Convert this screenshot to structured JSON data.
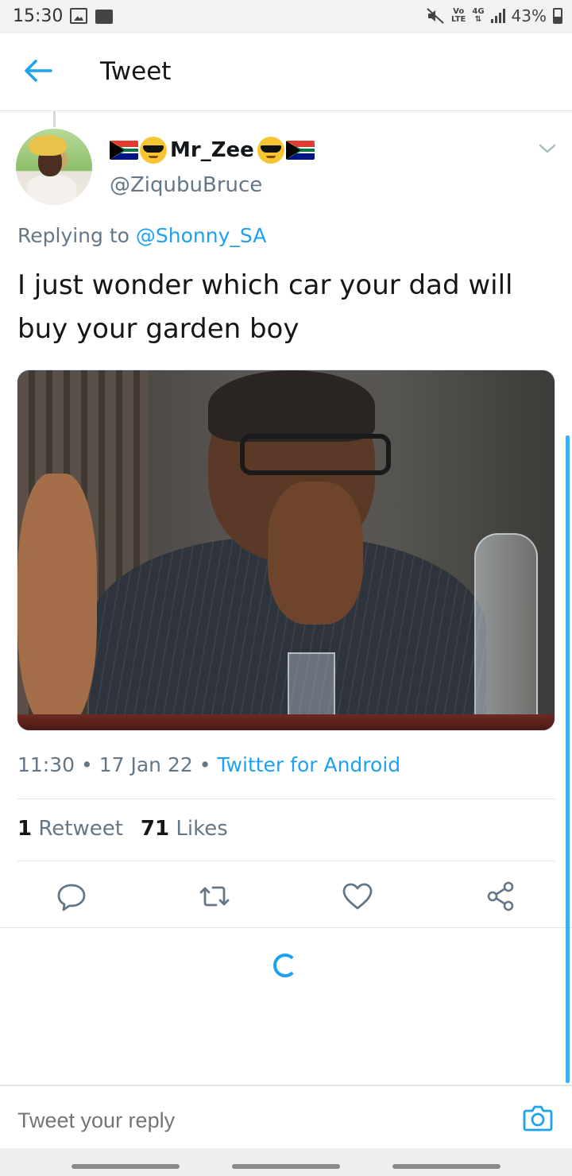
{
  "status_bar": {
    "time": "15:30",
    "network_top": "Vo",
    "network_bottom": "LTE",
    "data_top": "4G",
    "data_arrows": "⇅",
    "battery": "43%"
  },
  "header": {
    "title": "Tweet"
  },
  "tweet": {
    "display_name": "Mr_Zee",
    "handle": "@ZiqubuBruce",
    "replying_prefix": "Replying to",
    "replying_to": "@Shonny_SA",
    "text": "I just wonder which car your dad will buy your garden boy",
    "time": "11:30",
    "separator": "•",
    "date": "17 Jan 22",
    "source": "Twitter for Android",
    "retweets_count": "1",
    "retweets_label": "Retweet",
    "likes_count": "71",
    "likes_label": "Likes"
  },
  "reply": {
    "placeholder": "Tweet your reply"
  },
  "colors": {
    "accent": "#1da1f2",
    "secondary_text": "#657786",
    "primary_text": "#14171a"
  }
}
